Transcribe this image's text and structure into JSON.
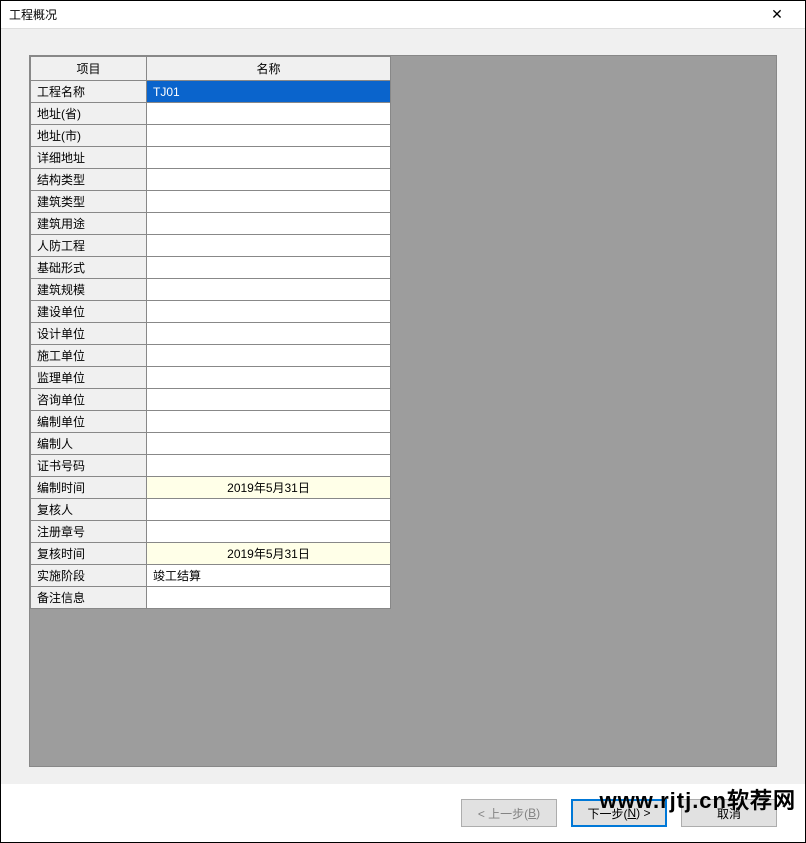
{
  "window": {
    "title": "工程概况"
  },
  "headers": {
    "col1": "项目",
    "col2": "名称"
  },
  "rows": [
    {
      "label": "工程名称",
      "value": "TJ01",
      "selected": true
    },
    {
      "label": "地址(省)",
      "value": ""
    },
    {
      "label": "地址(市)",
      "value": ""
    },
    {
      "label": "详细地址",
      "value": ""
    },
    {
      "label": "结构类型",
      "value": ""
    },
    {
      "label": "建筑类型",
      "value": ""
    },
    {
      "label": "建筑用途",
      "value": ""
    },
    {
      "label": "人防工程",
      "value": ""
    },
    {
      "label": "基础形式",
      "value": ""
    },
    {
      "label": "建筑规模",
      "value": ""
    },
    {
      "label": "建设单位",
      "value": ""
    },
    {
      "label": "设计单位",
      "value": ""
    },
    {
      "label": "施工单位",
      "value": ""
    },
    {
      "label": "监理单位",
      "value": ""
    },
    {
      "label": "咨询单位",
      "value": ""
    },
    {
      "label": "编制单位",
      "value": ""
    },
    {
      "label": "编制人",
      "value": ""
    },
    {
      "label": "证书号码",
      "value": ""
    },
    {
      "label": "编制时间",
      "value": "2019年5月31日",
      "date": true
    },
    {
      "label": "复核人",
      "value": ""
    },
    {
      "label": "注册章号",
      "value": ""
    },
    {
      "label": "复核时间",
      "value": "2019年5月31日",
      "date": true
    },
    {
      "label": "实施阶段",
      "value": "竣工结算"
    },
    {
      "label": "备注信息",
      "value": ""
    }
  ],
  "buttons": {
    "back_prefix": "< 上一步(",
    "back_key": "B",
    "back_suffix": ")",
    "next_prefix": "下一步(",
    "next_key": "N",
    "next_suffix": ") >",
    "cancel": "取消"
  },
  "watermark": "www.rjtj.cn软荐网"
}
